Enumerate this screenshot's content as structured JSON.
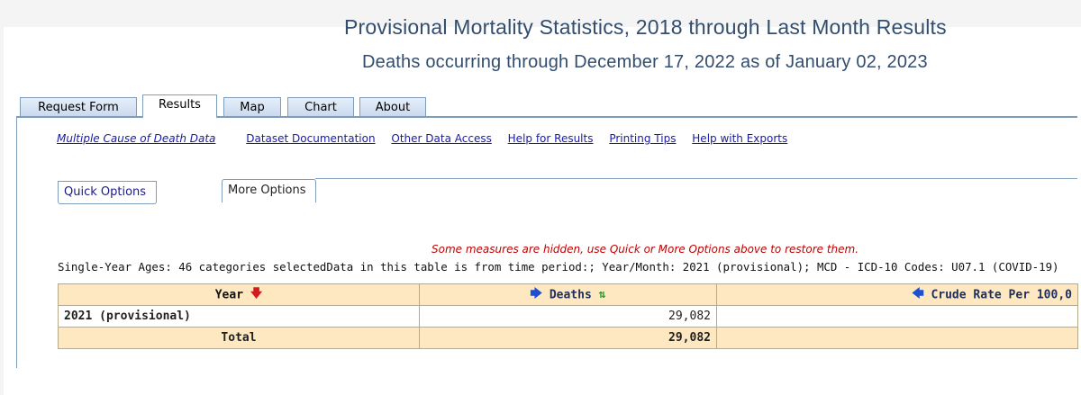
{
  "header": {
    "title": "Provisional Mortality Statistics, 2018 through Last Month Results",
    "subtitle": "Deaths occurring through December 17, 2022 as of January 02, 2023"
  },
  "tabs": [
    {
      "label": "Request Form"
    },
    {
      "label": "Results"
    },
    {
      "label": "Map"
    },
    {
      "label": "Chart"
    },
    {
      "label": "About"
    }
  ],
  "active_tab": "Results",
  "links": [
    "Multiple Cause of Death Data",
    "Dataset Documentation",
    "Other Data Access",
    "Help for Results",
    "Printing Tips",
    "Help with Exports"
  ],
  "subtabs": {
    "quick": "Quick Options",
    "more": "More Options"
  },
  "messages": {
    "hidden": "Some measures are hidden, use Quick or More Options above to restore them.",
    "summary": "Single-Year Ages: 46 categories selectedData in this table is from time period:; Year/Month: 2021 (provisional); MCD - ICD-10 Codes: U07.1 (COVID-19)"
  },
  "table": {
    "headers": {
      "year": "Year",
      "deaths": "Deaths",
      "rate": "Crude Rate Per 100,0"
    },
    "rows": [
      {
        "year": "2021 (provisional)",
        "deaths": "29,082",
        "rate": ""
      }
    ],
    "total": {
      "label": "Total",
      "deaths": "29,082",
      "rate": ""
    }
  },
  "icons": {
    "sort_down": "down-arrow-red-icon",
    "move_right": "right-arrow-blue-icon",
    "sort_updown": "up-down-arrows-green-icon",
    "move_left": "left-arrow-blue-icon"
  },
  "colors": {
    "title": "#334d6e",
    "link": "#1a1aa6",
    "warning": "#c00000",
    "table_header_bg": "#fde8c2"
  }
}
